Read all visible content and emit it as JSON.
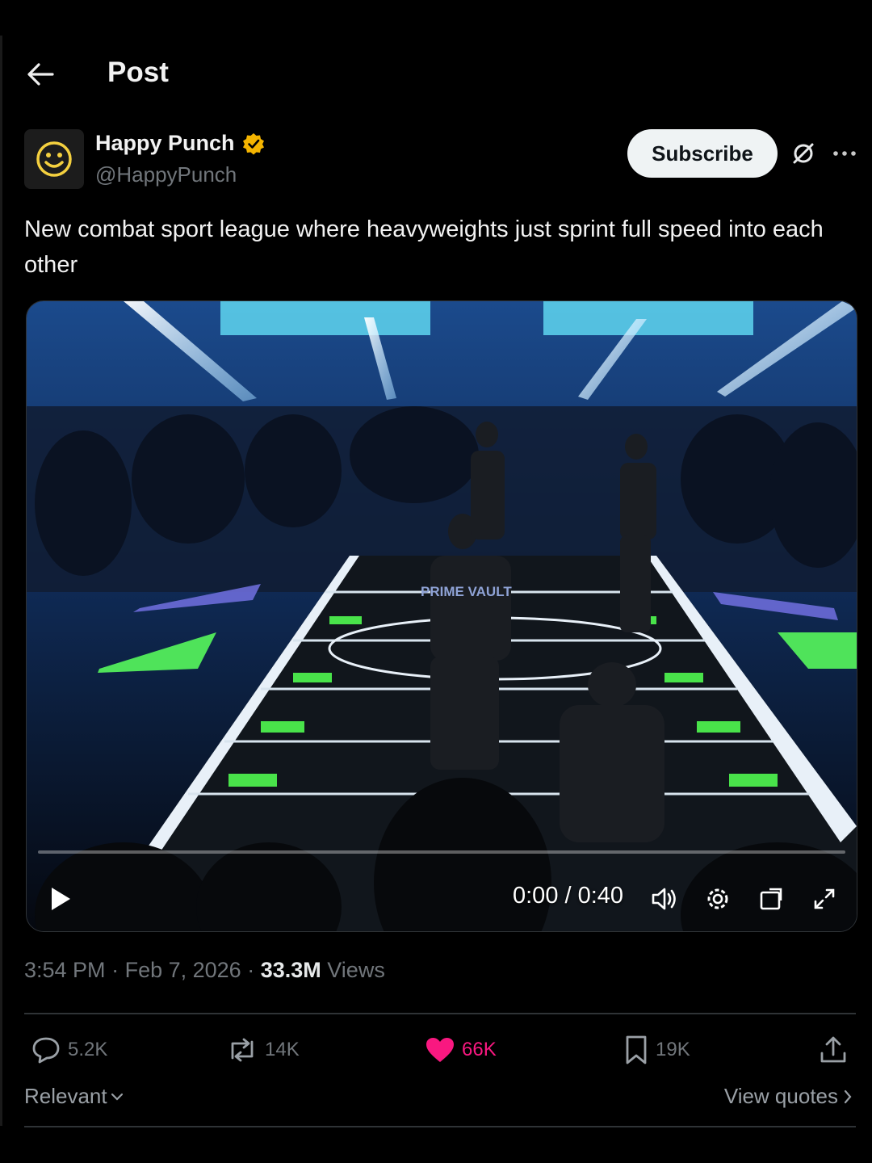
{
  "header": {
    "title": "Post"
  },
  "author": {
    "name": "Happy Punch",
    "handle": "@HappyPunch",
    "verified": true,
    "verified_color": "#f4b400"
  },
  "buttons": {
    "subscribe_label": "Subscribe"
  },
  "post": {
    "text": "New combat sport league where heavyweights just sprint full speed into each other"
  },
  "video": {
    "timecode": "0:00 / 0:40",
    "progress": 0,
    "controls": [
      "play-icon",
      "volume-icon",
      "settings-icon",
      "picture-in-picture-icon",
      "fullscreen-icon"
    ],
    "jersey_text": "PRIME VAULT"
  },
  "meta": {
    "time": "3:54 PM",
    "date": "Feb 7, 2026",
    "views_count": "33.3M",
    "views_label": "Views"
  },
  "actions": {
    "replies": "5.2K",
    "reposts": "14K",
    "likes": "66K",
    "bookmarks": "19K",
    "like_color": "#f91880"
  },
  "footer": {
    "sort_label": "Relevant",
    "quotes_label": "View quotes"
  }
}
